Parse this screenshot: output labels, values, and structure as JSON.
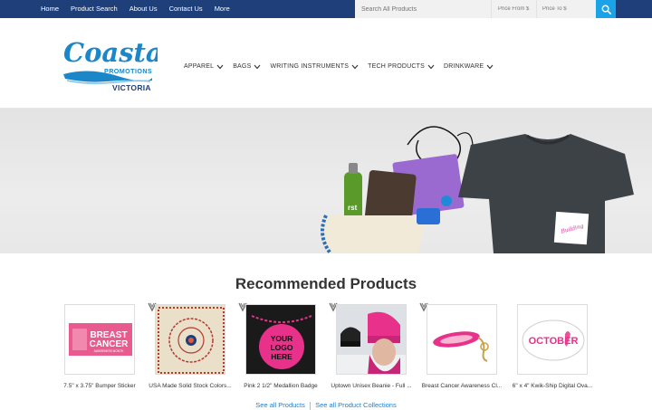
{
  "topnav": {
    "items": [
      "Home",
      "Product Search",
      "About Us",
      "Contact Us",
      "More"
    ]
  },
  "search": {
    "placeholder": "Search All Products",
    "price_from_placeholder": "Price From $",
    "price_to_placeholder": "Price To $",
    "button_icon": "search-icon"
  },
  "logo": {
    "line1": "Coastal",
    "line2": "PROMOTIONS",
    "line3": "VICTORIA"
  },
  "mainnav": {
    "items": [
      "APPAREL",
      "BAGS",
      "WRITING INSTRUMENTS",
      "TECH PRODUCTS",
      "DRINKWARE"
    ]
  },
  "hero": {
    "tshirt_label": "Building"
  },
  "recommended": {
    "title": "Recommended Products",
    "products": [
      {
        "name": "7.5\" x 3.75\" Bumper Sticker",
        "image_text": [
          "BREAST",
          "CANCER",
          "AWARENESS MONTH"
        ]
      },
      {
        "name": "USA Made Solid Stock Colors...",
        "image_text": []
      },
      {
        "name": "Pink 2 1/2\" Medallion Badge",
        "image_text": [
          "YOUR",
          "LOGO",
          "HERE"
        ]
      },
      {
        "name": "Uptown Unisex Beanie - Full ...",
        "image_text": []
      },
      {
        "name": "Breast Cancer Awareness Cl...",
        "image_text": []
      },
      {
        "name": "6\" x 4\" Kwik-Ship Digital Ova...",
        "image_text": [
          "OCTOBER"
        ]
      }
    ],
    "see_all_products": "See all Products",
    "see_all_collections": "See all Product Collections"
  },
  "colors": {
    "topbar": "#1e3f7a",
    "search_button": "#1aa3e8",
    "link": "#1a7fd0",
    "brand_blue": "#1b86c8",
    "pink": "#e8318a"
  }
}
